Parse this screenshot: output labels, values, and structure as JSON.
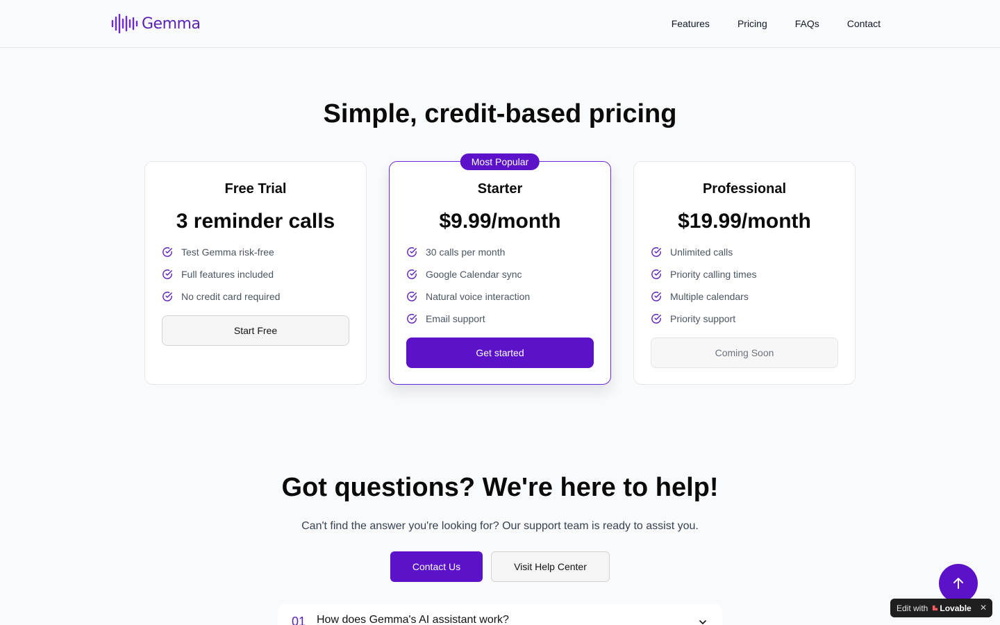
{
  "header": {
    "logo_text": "Gemma",
    "nav": [
      "Features",
      "Pricing",
      "FAQs",
      "Contact"
    ]
  },
  "pricing": {
    "title": "Simple, credit-based pricing",
    "plans": [
      {
        "name": "Free Trial",
        "price": "3 reminder calls",
        "features": [
          "Test Gemma risk-free",
          "Full features included",
          "No credit card required"
        ],
        "button": "Start Free"
      },
      {
        "badge": "Most Popular",
        "name": "Starter",
        "price": "$9.99/month",
        "features": [
          "30 calls per month",
          "Google Calendar sync",
          "Natural voice interaction",
          "Email support"
        ],
        "button": "Get started"
      },
      {
        "name": "Professional",
        "price": "$19.99/month",
        "features": [
          "Unlimited calls",
          "Priority calling times",
          "Multiple calendars",
          "Priority support"
        ],
        "button": "Coming Soon"
      }
    ]
  },
  "support": {
    "title": "Got questions? We're here to help!",
    "subtitle": "Can't find the answer you're looking for? Our support team is ready to assist you.",
    "contact_button": "Contact Us",
    "help_button": "Visit Help Center"
  },
  "faq": [
    {
      "num": "01",
      "question": "How does Gemma's AI assistant work?"
    }
  ],
  "floating": {
    "edit_label": "Edit with",
    "brand": "Lovable"
  },
  "colors": {
    "accent": "#5b12c9",
    "card_border": "#e5e7eb",
    "featured_border": "#6d28d9"
  }
}
